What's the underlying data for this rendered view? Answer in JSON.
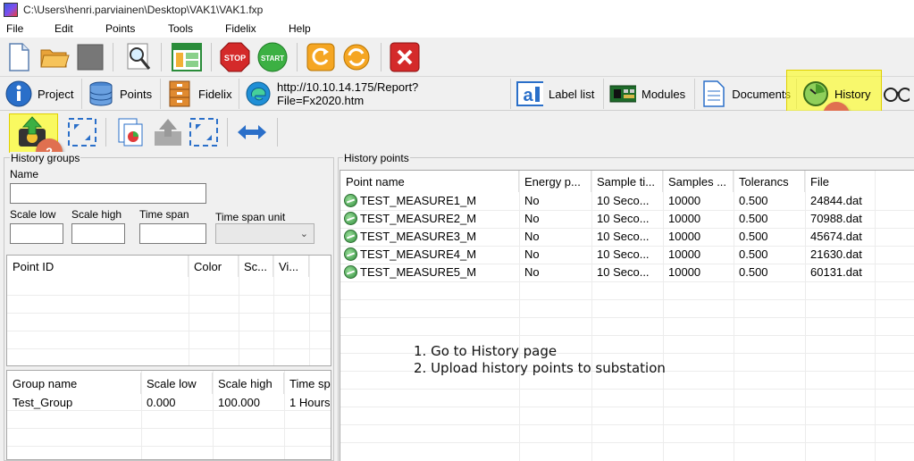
{
  "window": {
    "title": "C:\\Users\\henri.parviainen\\Desktop\\VAK1\\VAK1.fxp"
  },
  "menu": [
    "File",
    "Edit",
    "Points",
    "Tools",
    "Fidelix",
    "Help"
  ],
  "toolbar": {
    "stop_label": "STOP",
    "start_label": "START"
  },
  "nav": {
    "project": "Project",
    "points": "Points",
    "fidelix": "Fidelix",
    "url": "http://10.10.14.175/Report?File=Fx2020.htm",
    "label_list": "Label list",
    "modules": "Modules",
    "documents": "Documents",
    "history": "History"
  },
  "badges": {
    "one": "1",
    "two": "2"
  },
  "history_groups": {
    "title": "History groups",
    "name_label": "Name",
    "name_value": "",
    "scale_low_label": "Scale low",
    "scale_high_label": "Scale high",
    "time_span_label": "Time span",
    "time_span_unit_label": "Time span unit",
    "scale_low_value": "",
    "scale_high_value": "",
    "time_span_value": "",
    "time_span_unit_value": "",
    "points_columns": [
      "Point ID",
      "Color",
      "Sc...",
      "Vi..."
    ],
    "group_columns": [
      "Group name",
      "Scale low",
      "Scale high",
      "Time sp"
    ],
    "groups": [
      {
        "name": "Test_Group",
        "scale_low": "0.000",
        "scale_high": "100.000",
        "time_span": "1 Hours"
      }
    ]
  },
  "history_points": {
    "title": "History points",
    "columns": [
      "Point name",
      "Energy p...",
      "Sample ti...",
      "Samples ...",
      "Tolerancs",
      "File"
    ],
    "rows": [
      {
        "name": "TEST_MEASURE1_M",
        "energy": "No",
        "sample_time": "10 Seco...",
        "samples": "10000",
        "tolerance": "0.500",
        "file": "24844.dat"
      },
      {
        "name": "TEST_MEASURE2_M",
        "energy": "No",
        "sample_time": "10 Seco...",
        "samples": "10000",
        "tolerance": "0.500",
        "file": "70988.dat"
      },
      {
        "name": "TEST_MEASURE3_M",
        "energy": "No",
        "sample_time": "10 Seco...",
        "samples": "10000",
        "tolerance": "0.500",
        "file": "45674.dat"
      },
      {
        "name": "TEST_MEASURE4_M",
        "energy": "No",
        "sample_time": "10 Seco...",
        "samples": "10000",
        "tolerance": "0.500",
        "file": "21630.dat"
      },
      {
        "name": "TEST_MEASURE5_M",
        "energy": "No",
        "sample_time": "10 Seco...",
        "samples": "10000",
        "tolerance": "0.500",
        "file": "60131.dat"
      }
    ]
  },
  "instructions": {
    "line1": "1. Go to History page",
    "line2": "2. Upload history points to substation"
  }
}
